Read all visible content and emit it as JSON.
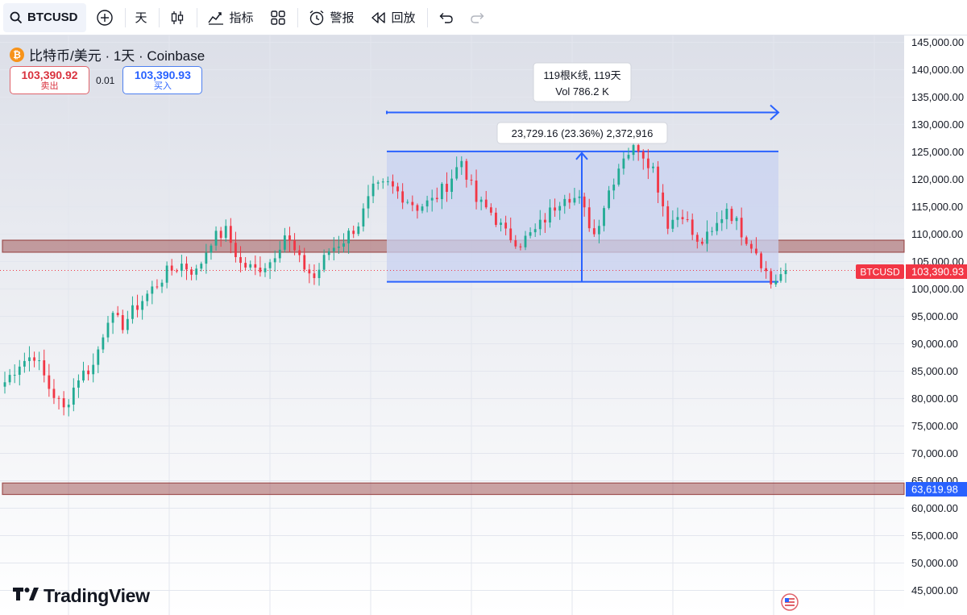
{
  "toolbar": {
    "symbol": "BTCUSD",
    "interval": "天",
    "indicators_label": "指标",
    "alerts_label": "警报",
    "replay_label": "回放"
  },
  "legend": {
    "title": "比特币/美元 · 1天 · Coinbase",
    "sell_price": "103,390.92",
    "sell_label": "卖出",
    "spread": "0.01",
    "buy_price": "103,390.93",
    "buy_label": "买入"
  },
  "colors": {
    "up": "#22ab94",
    "down": "#f23645",
    "accent": "#2962ff",
    "zone": "#8b2b2b",
    "range_fill": "#c8d2f0"
  },
  "annotations": {
    "range_label_line1": "119根K线, 119天",
    "range_label_line2": "Vol 786.2 K",
    "price_range_label": "23,729.16 (23.36%) 2,372,916"
  },
  "price_badges": {
    "current_symbol": "BTCUSD",
    "current_price": "103,390.93",
    "support_price": "63,619.98"
  },
  "branding": {
    "logo_text": "TradingView"
  },
  "chart_data": {
    "type": "candlestick",
    "y_axis_ticks": [
      145000,
      140000,
      135000,
      130000,
      125000,
      120000,
      115000,
      110000,
      105000,
      100000,
      95000,
      90000,
      85000,
      80000,
      75000,
      70000,
      65000,
      60000,
      55000,
      50000,
      45000
    ],
    "y_axis_tick_labels": [
      "145,000.00",
      "140,000.00",
      "135,000.00",
      "130,000.00",
      "125,000.00",
      "120,000.00",
      "115,000.00",
      "110,000.00",
      "105,000.00",
      "100,000.00",
      "95,000.00",
      "90,000.00",
      "85,000.00",
      "80,000.00",
      "75,000.00",
      "70,000.00",
      "65,000.00",
      "60,000.00",
      "55,000.00",
      "50,000.00",
      "45,000.00"
    ],
    "ylim": [
      43000,
      147000
    ],
    "last_price": 103390.93,
    "zones": [
      {
        "low": 106700,
        "high": 108900
      },
      {
        "low": 62500,
        "high": 64600
      }
    ],
    "measure_box": {
      "low": 101300,
      "high": 125100,
      "bars": 119
    },
    "close_path": [
      83000,
      86500,
      88000,
      82000,
      78000,
      84000,
      86000,
      95000,
      93500,
      97000,
      100000,
      103000,
      104500,
      103000,
      109000,
      110500,
      104500,
      103500,
      105000,
      110000,
      105000,
      102000,
      107000,
      109000,
      112000,
      118000,
      119000,
      117000,
      115000,
      116000,
      119000,
      123500,
      116000,
      114000,
      110000,
      108500,
      110500,
      114000,
      117500,
      116000,
      110000,
      118000,
      124500,
      126000,
      122000,
      112000,
      114000,
      108000,
      110000,
      115000,
      110500,
      107000,
      101000,
      103400
    ],
    "steps_per_segment": 3
  }
}
